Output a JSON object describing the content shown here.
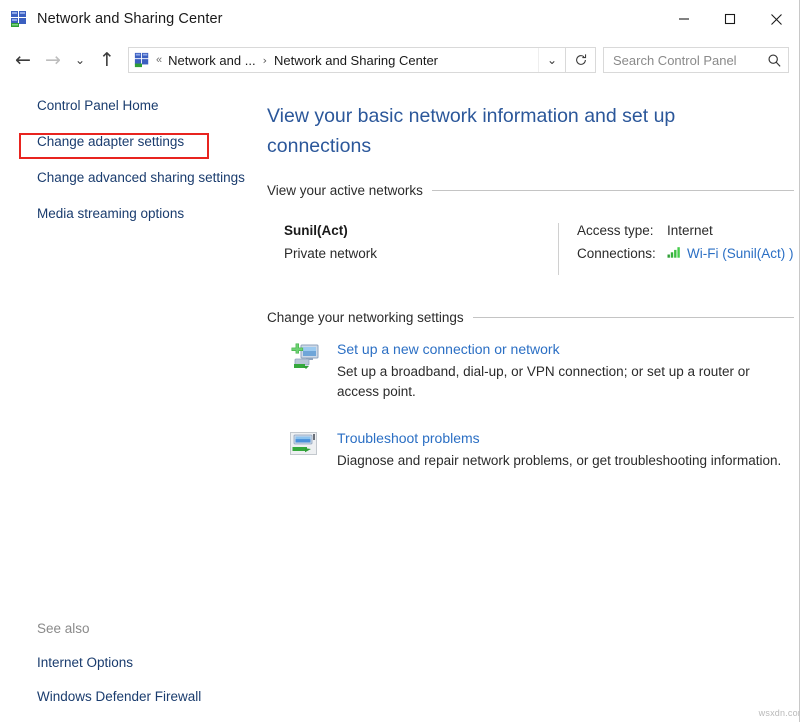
{
  "window": {
    "title": "Network and Sharing Center",
    "icon": "network-sharing-icon",
    "minimize_label": "–",
    "maximize_label": "□",
    "close_label": "✕"
  },
  "navbar": {
    "back_label": "←",
    "forward_label": "→",
    "recent_label": "⌄",
    "up_label": "↑",
    "address": {
      "icon": "network-sharing-icon",
      "ellipsis": "«",
      "crumb1": "Network and ...",
      "separator": "›",
      "crumb2": "Network and Sharing Center",
      "dropdown_label": "⌄"
    },
    "refresh_label": "refresh-icon",
    "search": {
      "placeholder": "Search Control Panel",
      "value": "",
      "icon": "search-icon"
    }
  },
  "sidebar": {
    "items": [
      {
        "label": "Control Panel Home"
      },
      {
        "label": "Change adapter settings"
      },
      {
        "label": "Change advanced sharing settings"
      },
      {
        "label": "Media streaming options"
      }
    ],
    "see_also": {
      "title": "See also",
      "items": [
        {
          "label": "Internet Options"
        },
        {
          "label": "Windows Defender Firewall"
        }
      ]
    },
    "highlight_color": "#e8241f"
  },
  "main": {
    "heading": "View your basic network information and set up connections",
    "active_networks": {
      "section_title": "View your active networks",
      "network_name": "Sunil(Act)",
      "network_type": "Private network",
      "access_type_key": "Access type:",
      "access_type_value": "Internet",
      "connections_key": "Connections:",
      "connections_value": "Wi-Fi (Sunil(Act) )",
      "signal_icon": "wifi-signal-icon",
      "signal_color": "#3aa13a"
    },
    "networking_settings": {
      "section_title": "Change your networking settings",
      "tasks": [
        {
          "icon": "new-connection-icon",
          "link": "Set up a new connection or network",
          "description": "Set up a broadband, dial-up, or VPN connection; or set up a router or access point."
        },
        {
          "icon": "troubleshoot-icon",
          "link": "Troubleshoot problems",
          "description": "Diagnose and repair network problems, or get troubleshooting information."
        }
      ]
    },
    "link_color": "#2b6fc4",
    "heading_color": "#2b579a"
  },
  "watermark": "wsxdn.com"
}
